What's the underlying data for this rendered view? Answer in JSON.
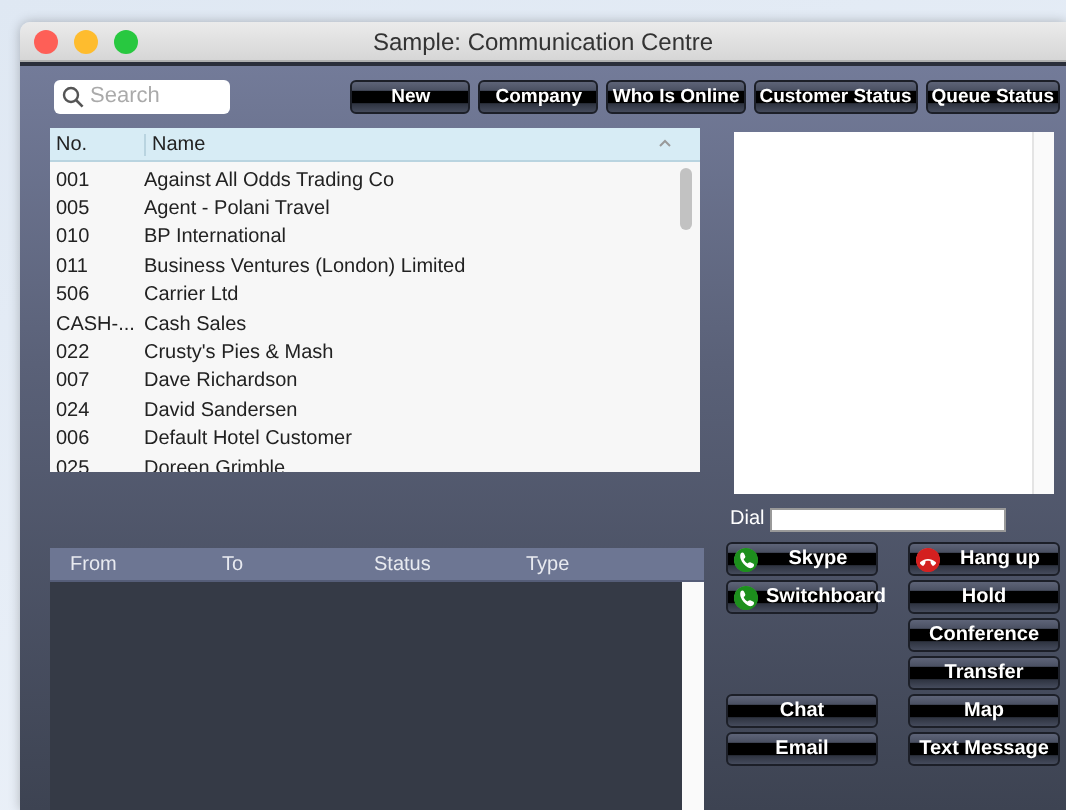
{
  "window": {
    "title": "Sample: Communication Centre"
  },
  "search": {
    "placeholder": "Search"
  },
  "toolbar_buttons": [
    "New",
    "Company",
    "Who Is Online",
    "Customer Status",
    "Queue Status"
  ],
  "customers": {
    "columns": [
      "No.",
      "Name"
    ],
    "rows": [
      {
        "no": "001",
        "name": "Against All Odds Trading Co"
      },
      {
        "no": "005",
        "name": "Agent - Polani Travel"
      },
      {
        "no": "010",
        "name": "BP International"
      },
      {
        "no": "011",
        "name": "Business Ventures (London) Limited"
      },
      {
        "no": "506",
        "name": "Carrier Ltd"
      },
      {
        "no": "CASH-...",
        "name": "Cash Sales"
      },
      {
        "no": "022",
        "name": "Crusty's Pies & Mash"
      },
      {
        "no": "007",
        "name": "Dave Richardson"
      },
      {
        "no": "024",
        "name": "David Sandersen"
      },
      {
        "no": "006",
        "name": "Default Hotel Customer"
      },
      {
        "no": "025",
        "name": "Doreen Grimble"
      }
    ]
  },
  "calls": {
    "columns": [
      "From",
      "To",
      "Status",
      "Type"
    ]
  },
  "dial": {
    "label": "Dial"
  },
  "call_buttons": [
    {
      "label": "Skype",
      "kind": "call"
    },
    {
      "label": "Switchboard",
      "kind": "call"
    }
  ],
  "message_buttons": [
    {
      "label": "Chat"
    },
    {
      "label": "Email"
    }
  ],
  "control_buttons": [
    {
      "label": "Hang up",
      "kind": "hangup"
    },
    {
      "label": "Hold",
      "kind": "plain"
    },
    {
      "label": "Conference",
      "kind": "plain"
    },
    {
      "label": "Transfer",
      "kind": "plain"
    },
    {
      "label": "Map",
      "kind": "plain"
    },
    {
      "label": "Text Message",
      "kind": "plain"
    }
  ]
}
